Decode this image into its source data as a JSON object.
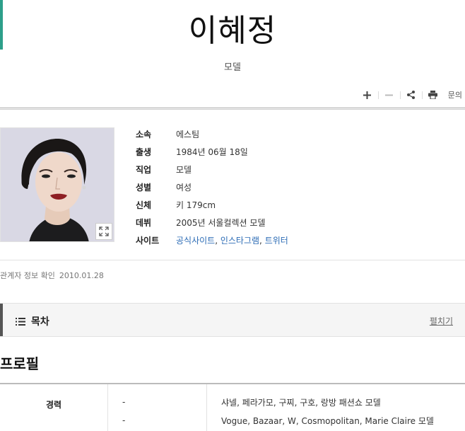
{
  "header": {
    "title": "이혜정",
    "subtitle": "모델"
  },
  "toolbar": {
    "add_icon": "plus-icon",
    "remove_icon": "minus-icon",
    "share_icon": "share-icon",
    "print_icon": "print-icon",
    "inquiry_label": "문의"
  },
  "profile": {
    "rows": [
      {
        "label": "소속",
        "value": "에스팀"
      },
      {
        "label": "출생",
        "value": "1984년 06월 18일"
      },
      {
        "label": "직업",
        "value": "모델"
      },
      {
        "label": "성별",
        "value": "여성"
      },
      {
        "label": "신체",
        "value": "키 179cm"
      },
      {
        "label": "데뷔",
        "value": "2005년 서울컬렉션 모델"
      }
    ],
    "site_label": "사이트",
    "site_links": [
      "공식사이트",
      "인스타그램",
      "트위터"
    ],
    "site_sep": ", "
  },
  "confirm": {
    "text": "관계자 정보 확인",
    "date": "2010.01.28"
  },
  "toc": {
    "title": "목차",
    "toggle": "펼치기"
  },
  "section": {
    "title": "프로필"
  },
  "career": {
    "label": "경력",
    "years": [
      "-",
      "-"
    ],
    "items": [
      "샤넬, 페라가모, 구찌, 구호, 랑방 패션쇼 모델",
      "Vogue, Bazaar, W, Cosmopolitan, Marie Claire 모델"
    ]
  },
  "colors": {
    "accent": "#2d9f8a",
    "link": "#2b6bb5"
  }
}
